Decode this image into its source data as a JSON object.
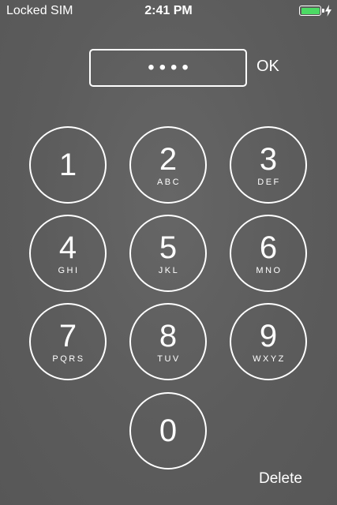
{
  "status_bar": {
    "carrier": "Locked SIM",
    "time": "2:41 PM",
    "battery_color": "#4cd964",
    "battery_level": 1.0,
    "charging_icon": "lightning-bolt-icon"
  },
  "pin_entry": {
    "masked_value": "••••",
    "ok_label": "OK"
  },
  "keypad": {
    "keys": [
      {
        "digit": "1",
        "letters": ""
      },
      {
        "digit": "2",
        "letters": "ABC"
      },
      {
        "digit": "3",
        "letters": "DEF"
      },
      {
        "digit": "4",
        "letters": "GHI"
      },
      {
        "digit": "5",
        "letters": "JKL"
      },
      {
        "digit": "6",
        "letters": "MNO"
      },
      {
        "digit": "7",
        "letters": "PQRS"
      },
      {
        "digit": "8",
        "letters": "TUV"
      },
      {
        "digit": "9",
        "letters": "WXYZ"
      },
      {
        "digit": "0",
        "letters": ""
      }
    ],
    "delete_label": "Delete"
  }
}
